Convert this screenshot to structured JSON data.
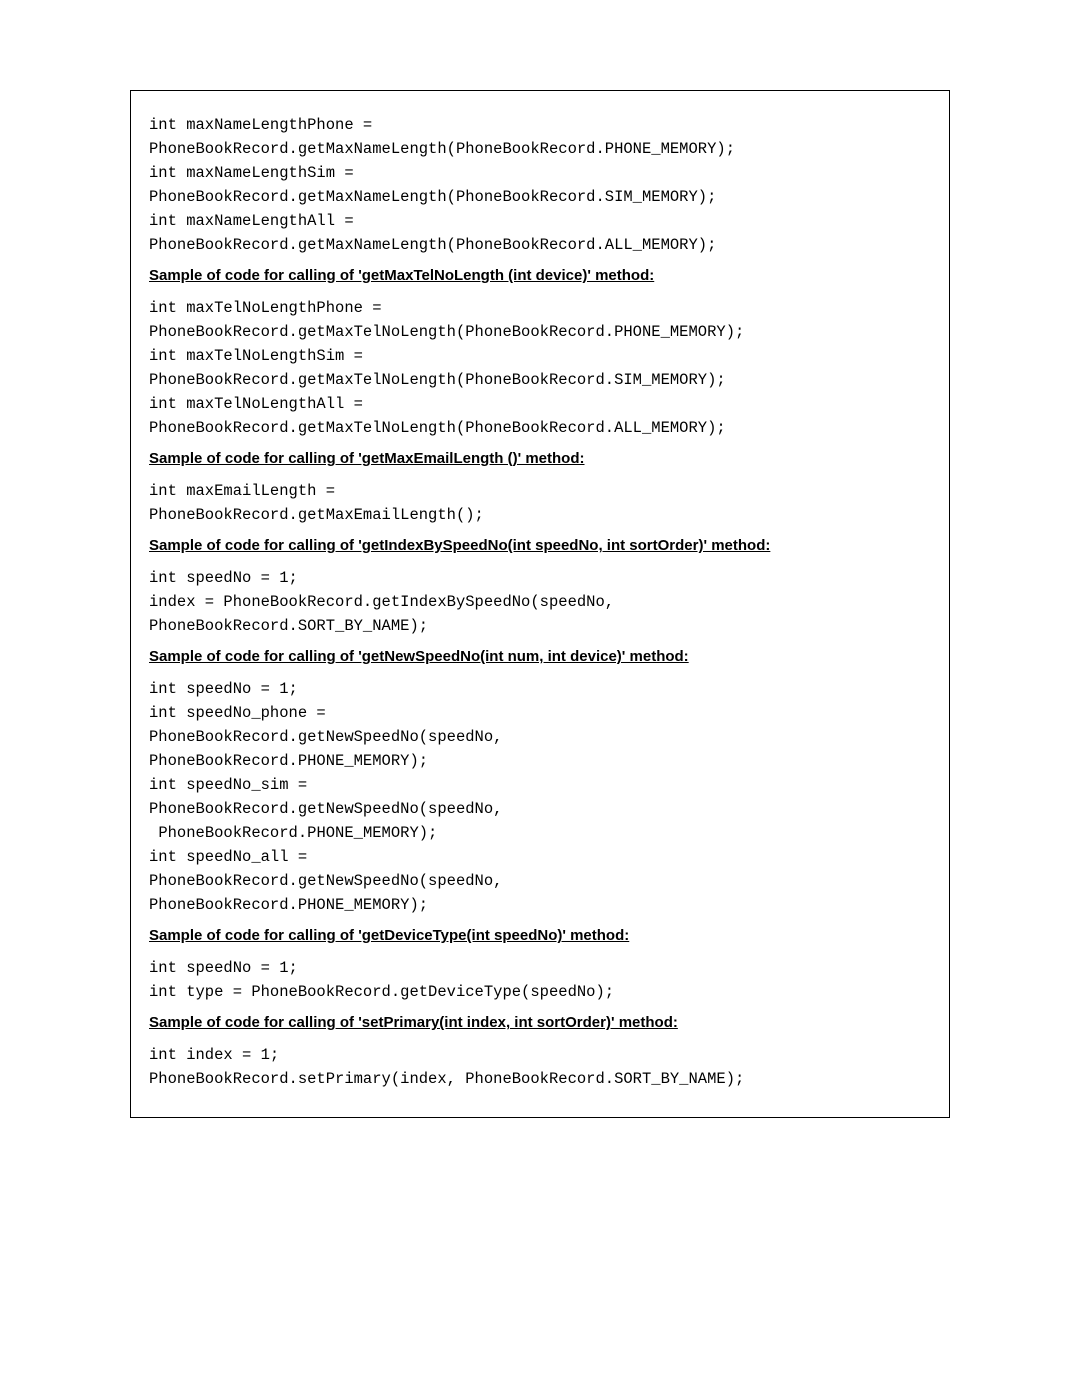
{
  "code_block_1": "int maxNameLengthPhone =\nPhoneBookRecord.getMaxNameLength(PhoneBookRecord.PHONE_MEMORY);\nint maxNameLengthSim =\nPhoneBookRecord.getMaxNameLength(PhoneBookRecord.SIM_MEMORY);\nint maxNameLengthAll =\nPhoneBookRecord.getMaxNameLength(PhoneBookRecord.ALL_MEMORY);",
  "heading_1": "Sample of code for calling of 'getMaxTelNoLength (int device)' method:",
  "code_block_2": "int maxTelNoLengthPhone =\nPhoneBookRecord.getMaxTelNoLength(PhoneBookRecord.PHONE_MEMORY);\nint maxTelNoLengthSim =\nPhoneBookRecord.getMaxTelNoLength(PhoneBookRecord.SIM_MEMORY);\nint maxTelNoLengthAll =\nPhoneBookRecord.getMaxTelNoLength(PhoneBookRecord.ALL_MEMORY);",
  "heading_2": "Sample of code for calling of 'getMaxEmailLength ()' method:",
  "code_block_3": "int maxEmailLength =\nPhoneBookRecord.getMaxEmailLength();",
  "heading_3": "Sample of code for calling of 'getIndexBySpeedNo(int speedNo, int sortOrder)' method:",
  "code_block_4": "int speedNo = 1;\nindex = PhoneBookRecord.getIndexBySpeedNo(speedNo,\nPhoneBookRecord.SORT_BY_NAME);",
  "heading_4": "Sample of code for calling of 'getNewSpeedNo(int num, int device)' method:",
  "code_block_5": "int speedNo = 1;\nint speedNo_phone =\nPhoneBookRecord.getNewSpeedNo(speedNo,\nPhoneBookRecord.PHONE_MEMORY);\nint speedNo_sim =\nPhoneBookRecord.getNewSpeedNo(speedNo,\n PhoneBookRecord.PHONE_MEMORY);\nint speedNo_all =\nPhoneBookRecord.getNewSpeedNo(speedNo,\nPhoneBookRecord.PHONE_MEMORY);",
  "heading_5": "Sample of code for calling of 'getDeviceType(int speedNo)' method:",
  "code_block_6": "int speedNo = 1;\nint type = PhoneBookRecord.getDeviceType(speedNo);",
  "heading_6": "Sample of code for calling of 'setPrimary(int index, int sortOrder)' method:",
  "code_block_7": "int index = 1;\nPhoneBookRecord.setPrimary(index, PhoneBookRecord.SORT_BY_NAME);"
}
